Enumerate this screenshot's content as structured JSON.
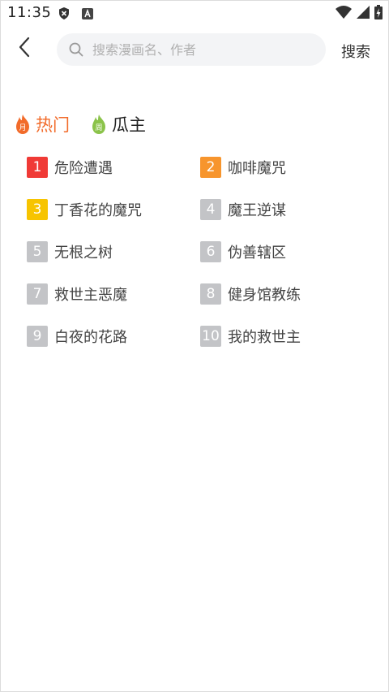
{
  "status_bar": {
    "time": "11:35",
    "icons": [
      "shield-x-icon",
      "app-a-icon",
      "wifi-icon",
      "signal-icon",
      "battery-charging-icon"
    ]
  },
  "header": {
    "back_icon": "chevron-left-icon",
    "search_placeholder": "搜索漫画名、作者",
    "search_value": "",
    "search_button": "搜索"
  },
  "tabs": [
    {
      "label": "热门",
      "icon": "fire-month-icon",
      "color": "#f26b2a",
      "active": true
    },
    {
      "label": "瓜主",
      "icon": "melon-week-icon",
      "color": "#8bc34a",
      "active": false
    }
  ],
  "rankings": [
    {
      "rank": "1",
      "title": "危险遭遇",
      "color": "#f03a36"
    },
    {
      "rank": "2",
      "title": "咖啡魔咒",
      "color": "#f7952d"
    },
    {
      "rank": "3",
      "title": "丁香花的魔咒",
      "color": "#f7c400"
    },
    {
      "rank": "4",
      "title": "魔王逆谋",
      "color": "#c3c4c7"
    },
    {
      "rank": "5",
      "title": "无根之树",
      "color": "#c3c4c7"
    },
    {
      "rank": "6",
      "title": "伪善辖区",
      "color": "#c3c4c7"
    },
    {
      "rank": "7",
      "title": "救世主恶魔",
      "color": "#c3c4c7"
    },
    {
      "rank": "8",
      "title": "健身馆教练",
      "color": "#c3c4c7"
    },
    {
      "rank": "9",
      "title": "白夜的花路",
      "color": "#c3c4c7"
    },
    {
      "rank": "10",
      "title": "我的救世主",
      "color": "#c3c4c7"
    }
  ]
}
